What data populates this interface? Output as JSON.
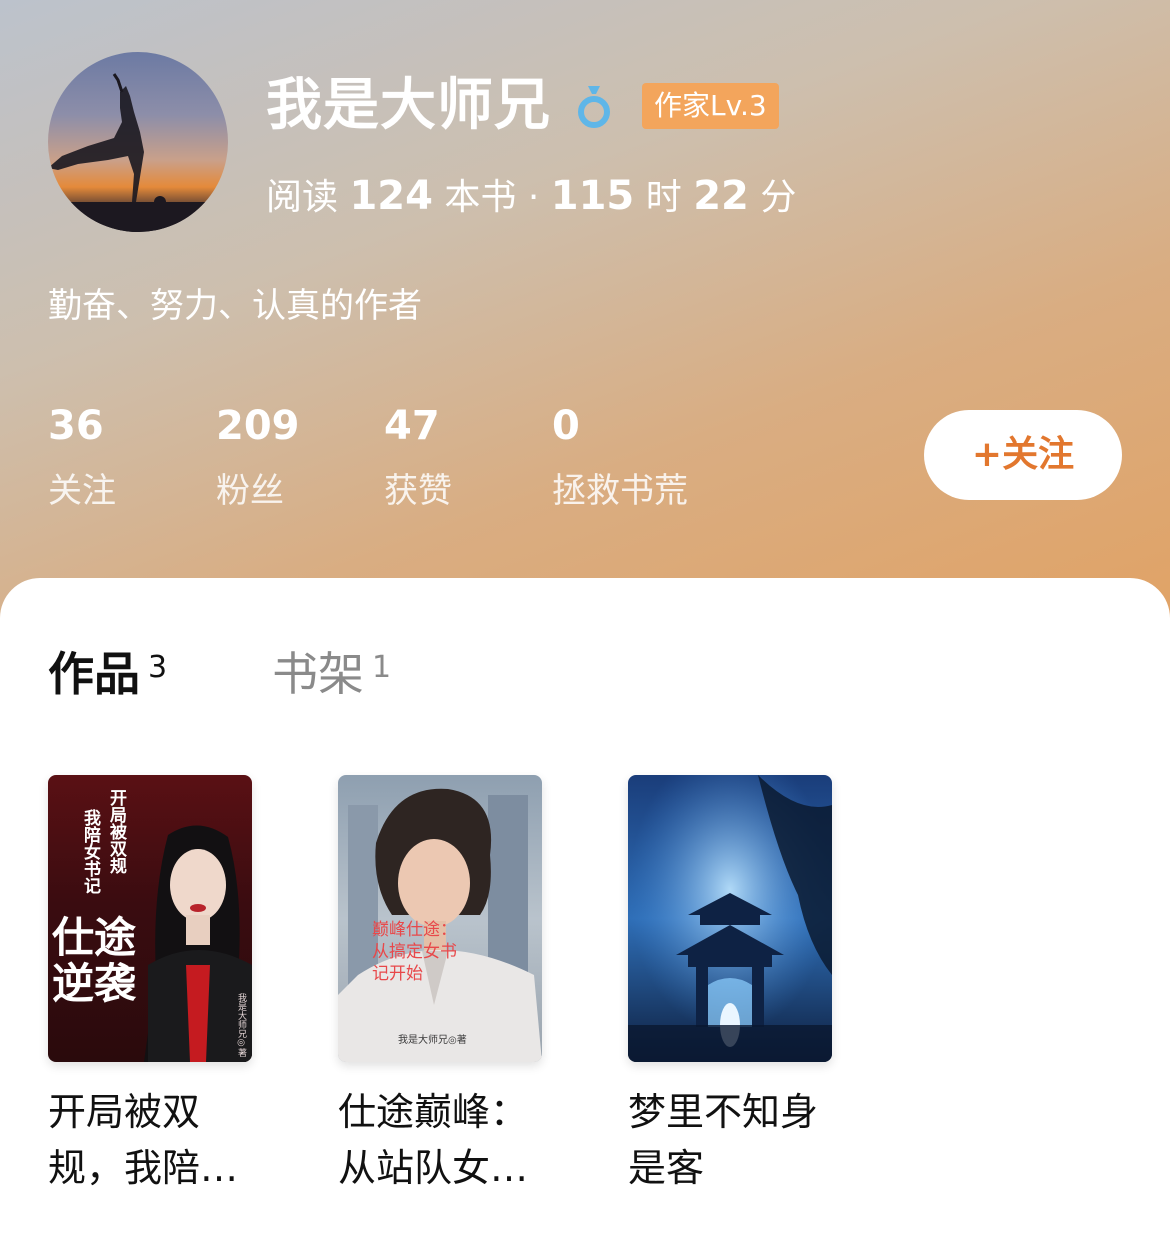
{
  "profile": {
    "username": "我是大师兄",
    "level_badge": "作家Lv.3",
    "reading": {
      "prefix": "阅读",
      "books": "124",
      "books_unit": "本书 ·",
      "hours": "115",
      "hours_unit": "时",
      "minutes": "22",
      "minutes_unit": "分"
    },
    "bio": "勤奋、努力、认真的作者"
  },
  "stats": [
    {
      "value": "36",
      "label": "关注"
    },
    {
      "value": "209",
      "label": "粉丝"
    },
    {
      "value": "47",
      "label": "获赞"
    },
    {
      "value": "0",
      "label": "拯救书荒"
    }
  ],
  "follow_button": "+关注",
  "tabs": [
    {
      "label": "作品",
      "count": "3"
    },
    {
      "label": "书架",
      "count": "1"
    }
  ],
  "books": [
    {
      "title": "开局被双规，我陪…",
      "cover_title_top": "开局被双规",
      "cover_title_sub": "我陪女书记",
      "cover_title_main": "仕途逆袭",
      "cover_author": "我是大师兄◎著"
    },
    {
      "title": "仕途巅峰：从站队女…",
      "cover_title_lines": [
        "巅峰仕途：",
        "从搞定女书",
        "记开始"
      ],
      "cover_author": "我是大师兄◎著"
    },
    {
      "title": "梦里不知身是客"
    }
  ],
  "colors": {
    "accent": "#e2772e",
    "badge": "#f3a55c",
    "vip_icon": "#5fb6e8"
  }
}
